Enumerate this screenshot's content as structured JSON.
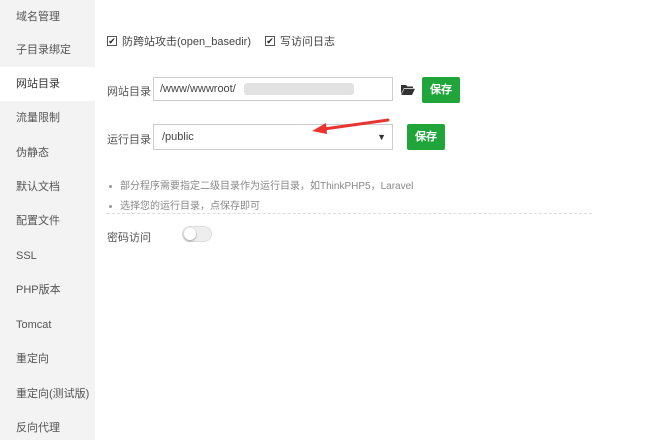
{
  "sidebar": {
    "items": [
      {
        "label": "域名管理"
      },
      {
        "label": "子目录绑定"
      },
      {
        "label": "网站目录"
      },
      {
        "label": "流量限制"
      },
      {
        "label": "伪静态"
      },
      {
        "label": "默认文档"
      },
      {
        "label": "配置文件"
      },
      {
        "label": "SSL"
      },
      {
        "label": "PHP版本"
      },
      {
        "label": "Tomcat"
      },
      {
        "label": "重定向"
      },
      {
        "label": "重定向(测试版)"
      },
      {
        "label": "反向代理"
      }
    ],
    "active_index": 2
  },
  "options": {
    "anti_xss_label": "防跨站攻击(open_basedir)",
    "anti_xss_checked": true,
    "access_log_label": "写访问日志",
    "access_log_checked": true
  },
  "site_dir": {
    "label": "网站目录",
    "value": "/www/wwwroot/",
    "save_label": "保存"
  },
  "run_dir": {
    "label": "运行目录",
    "selected": "/public",
    "save_label": "保存"
  },
  "tips": [
    "部分程序需要指定二级目录作为运行目录，如ThinkPHP5，Laravel",
    "选择您的运行目录，点保存即可"
  ],
  "password_access": {
    "label": "密码访问",
    "enabled": false
  },
  "colors": {
    "primary": "#20a53a",
    "annotation_arrow": "#e8332e"
  }
}
